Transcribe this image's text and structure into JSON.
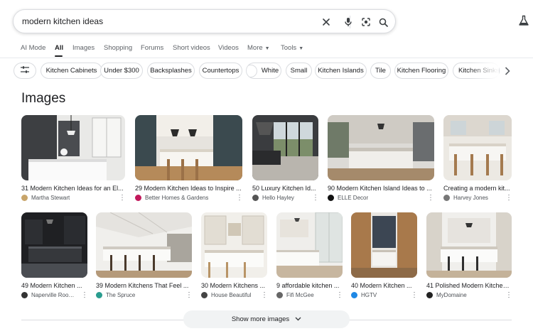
{
  "search": {
    "query": "modern kitchen ideas"
  },
  "icons": {
    "clear": "close-icon",
    "voice": "microphone-icon",
    "lens": "camera-lens-icon",
    "search": "search-icon",
    "labs": "flask-icon",
    "filter": "sliders-icon",
    "next": "chevron-right-icon",
    "expand": "chevron-down-icon"
  },
  "tabs": [
    {
      "label": "AI Mode"
    },
    {
      "label": "All"
    },
    {
      "label": "Images"
    },
    {
      "label": "Shopping"
    },
    {
      "label": "Forums"
    },
    {
      "label": "Short videos"
    },
    {
      "label": "Videos"
    },
    {
      "label": "More"
    },
    {
      "label": "Tools"
    }
  ],
  "chips": [
    {
      "label": "Kitchen Cabinets"
    },
    {
      "label": "Under $300"
    },
    {
      "label": "Backsplashes"
    },
    {
      "label": "Countertops"
    },
    {
      "label": "White"
    },
    {
      "label": "Small"
    },
    {
      "label": "Kitchen Islands"
    },
    {
      "label": "Tile"
    },
    {
      "label": "Kitchen Flooring"
    },
    {
      "label": "Kitchen Sinks"
    }
  ],
  "section_title": "Images",
  "images": [
    {
      "title": "31 Modern Kitchen Ideas for an El...",
      "source": "Martha Stewart",
      "fav_color": "#c8a56a"
    },
    {
      "title": "29 Modern Kitchen Ideas to Inspire ...",
      "source": "Better Homes & Gardens",
      "fav_color": "#c2185b"
    },
    {
      "title": "50 Luxury Kitchen Id...",
      "source": "Hello Hayley",
      "fav_color": "#555555"
    },
    {
      "title": "90 Modern Kitchen Island Ideas to ...",
      "source": "ELLE Decor",
      "fav_color": "#111111"
    },
    {
      "title": "Creating a modern kit...",
      "source": "Harvey Jones",
      "fav_color": "#777777"
    },
    {
      "title": "49 Modern Kitchen ...",
      "source": "Naperville Roof...",
      "fav_color": "#333333"
    },
    {
      "title": "39 Modern Kitchens That Feel ...",
      "source": "The Spruce",
      "fav_color": "#2a9d8f"
    },
    {
      "title": "30 Modern Kitchens ...",
      "source": "House Beautiful",
      "fav_color": "#444444"
    },
    {
      "title": "9 affordable kitchen ...",
      "source": "Fifi McGee",
      "fav_color": "#666666"
    },
    {
      "title": "40 Modern Kitchen ...",
      "source": "HGTV",
      "fav_color": "#1e88e5"
    },
    {
      "title": "41 Polished Modern Kitchen...",
      "source": "MyDomaine",
      "fav_color": "#222222"
    }
  ],
  "show_more_label": "Show more images"
}
